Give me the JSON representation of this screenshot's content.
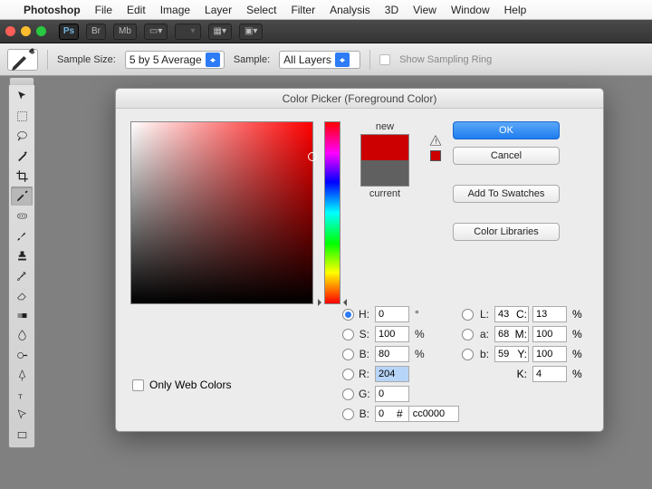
{
  "menubar": [
    "Photoshop",
    "File",
    "Edit",
    "Image",
    "Layer",
    "Select",
    "Filter",
    "Analysis",
    "3D",
    "View",
    "Window",
    "Help"
  ],
  "optionbar": {
    "sample_size_label": "Sample Size:",
    "sample_size_value": "5 by 5 Average",
    "sample_label": "Sample:",
    "sample_value": "All Layers",
    "show_ring": "Show Sampling Ring"
  },
  "dialog": {
    "title": "Color Picker (Foreground Color)",
    "new_label": "new",
    "current_label": "current",
    "new_color": "#cc0000",
    "current_color": "#606060",
    "ok": "OK",
    "cancel": "Cancel",
    "add_swatches": "Add To Swatches",
    "color_libraries": "Color Libraries",
    "only_web": "Only Web Colors",
    "hex_label": "#",
    "hex": "cc0000",
    "hsb": {
      "H": "0",
      "S": "100",
      "B": "80"
    },
    "rgb": {
      "R": "204",
      "G": "0",
      "B": "0"
    },
    "lab": {
      "L": "43",
      "a": "68",
      "b": "59"
    },
    "cmyk": {
      "C": "13",
      "M": "100",
      "Y": "100",
      "K": "4"
    }
  }
}
